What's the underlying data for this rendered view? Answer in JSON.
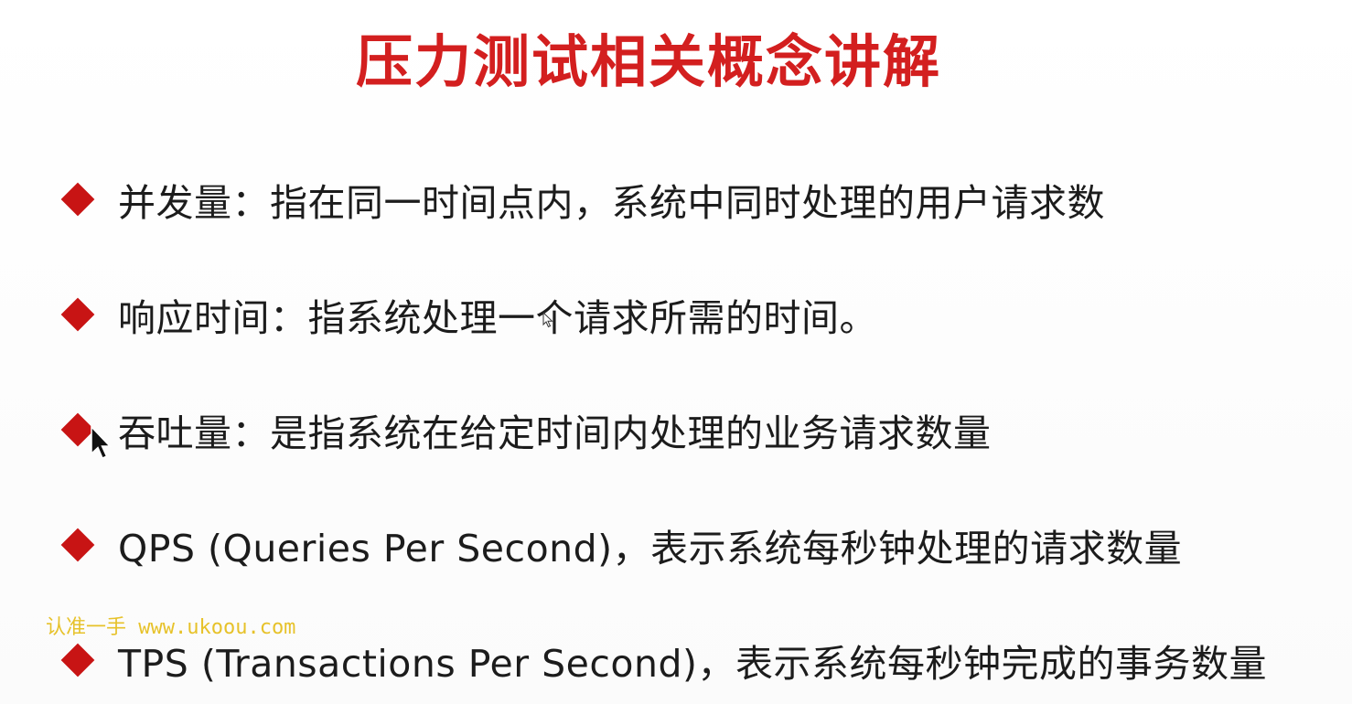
{
  "slide": {
    "title": "压力测试相关概念讲解",
    "colors": {
      "title": "#d31f1f",
      "bullet": "#c81414",
      "text": "#1c1c1c",
      "watermark": "#e7c22a"
    },
    "bullets": [
      {
        "text": "并发量：指在同一时间点内，系统中同时处理的用户请求数"
      },
      {
        "text": "响应时间：指系统处理一个请求所需的时间。"
      },
      {
        "text": "吞吐量：是指系统在给定时间内处理的业务请求数量"
      },
      {
        "text": "QPS (Queries Per Second)，表示系统每秒钟处理的请求数量"
      },
      {
        "text": "TPS (Transactions Per Second)，表示系统每秒钟完成的事务数量"
      }
    ],
    "watermark": "认准一手 www.ukoou.com",
    "icons": {
      "bullet": "diamond-bullet-icon",
      "cursor": "mouse-pointer-icon"
    }
  }
}
